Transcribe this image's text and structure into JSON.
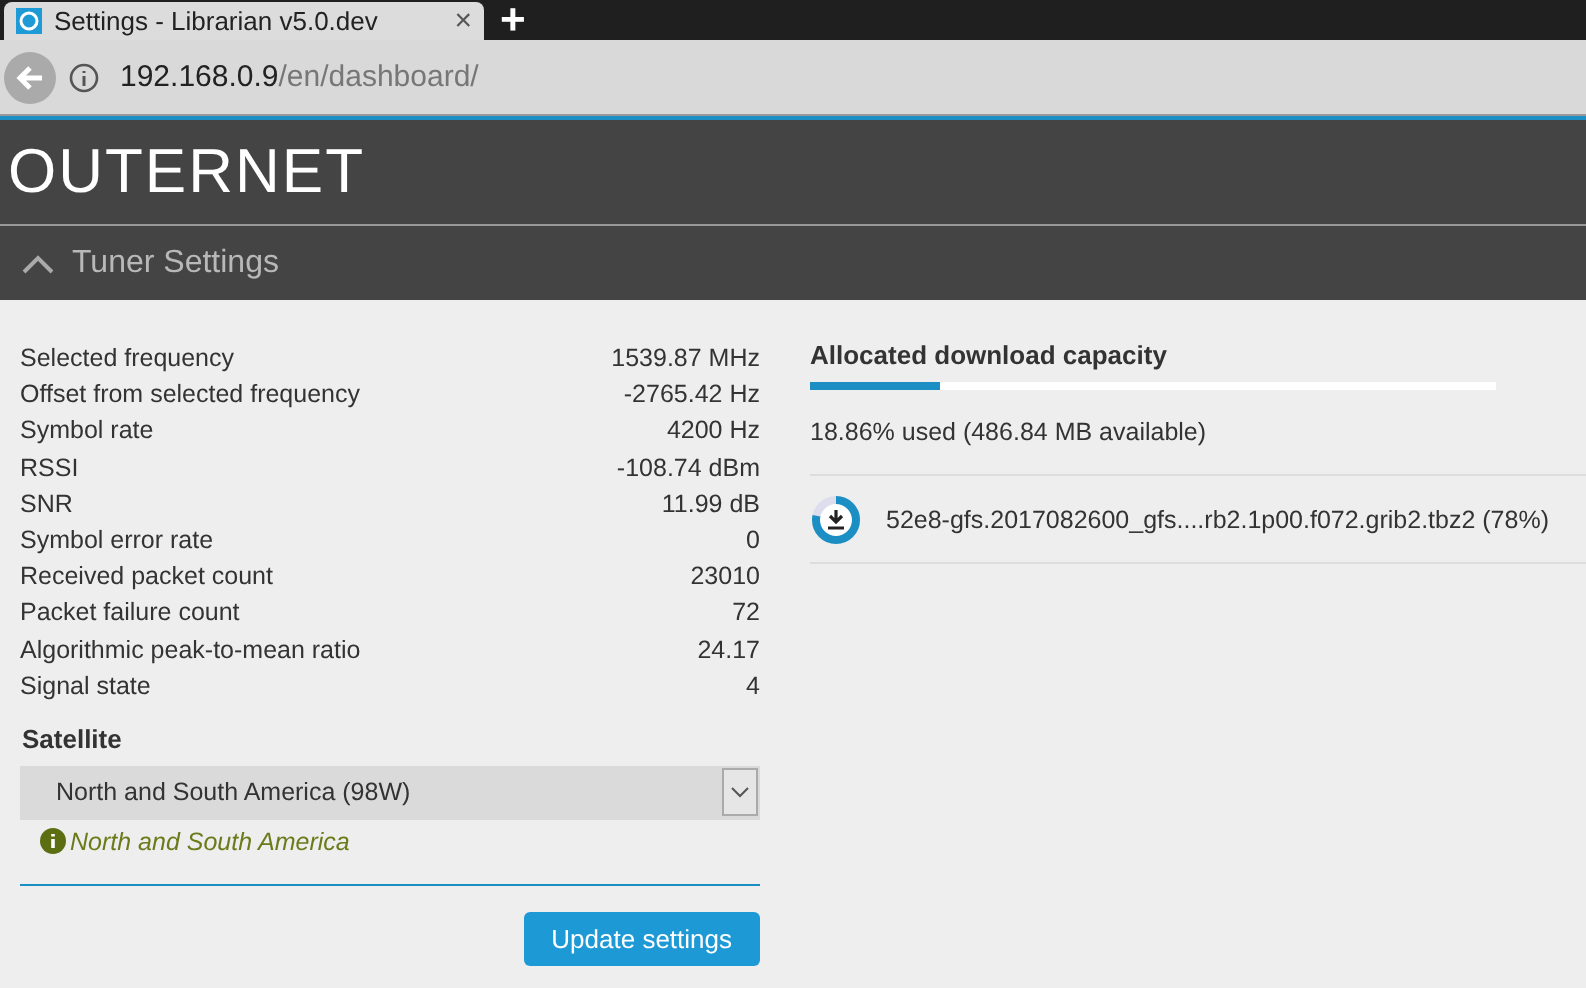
{
  "browser": {
    "tab_title": "Settings - Librarian v5.0.dev",
    "close": "×",
    "new_tab": "+",
    "address_host": "192.168.0.9",
    "address_path": "/en/dashboard/"
  },
  "header": {
    "logo": "OUTERNET"
  },
  "section": {
    "title": "Tuner Settings",
    "expanded": true
  },
  "stats": [
    {
      "label": "Selected frequency",
      "value": "1539.87 MHz"
    },
    {
      "label": "Offset from selected frequency",
      "value": "-2765.42 Hz"
    },
    {
      "label": "Symbol rate",
      "value": "4200 Hz"
    },
    {
      "label": "RSSI",
      "value": "-108.74 dBm"
    },
    {
      "label": "SNR",
      "value": "11.99 dB"
    },
    {
      "label": "Symbol error rate",
      "value": "0"
    },
    {
      "label": "Received packet count",
      "value": "23010"
    },
    {
      "label": "Packet failure count",
      "value": "72"
    },
    {
      "label": "Algorithmic peak-to-mean ratio",
      "value": "24.17"
    },
    {
      "label": "Signal state",
      "value": "4"
    }
  ],
  "satellite": {
    "label": "Satellite",
    "value": "North and South America (98W)",
    "help": "North and South America"
  },
  "update_button": "Update settings",
  "capacity": {
    "title": "Allocated download capacity",
    "level": 0.1886,
    "summary": "18.86% used (486.84 MB available)"
  },
  "downloads": [
    {
      "name": "52e8-gfs.2017082600_gfs....rb2.1p00.f072.grib2.tbz2 (78%)",
      "level": 0.78
    }
  ]
}
